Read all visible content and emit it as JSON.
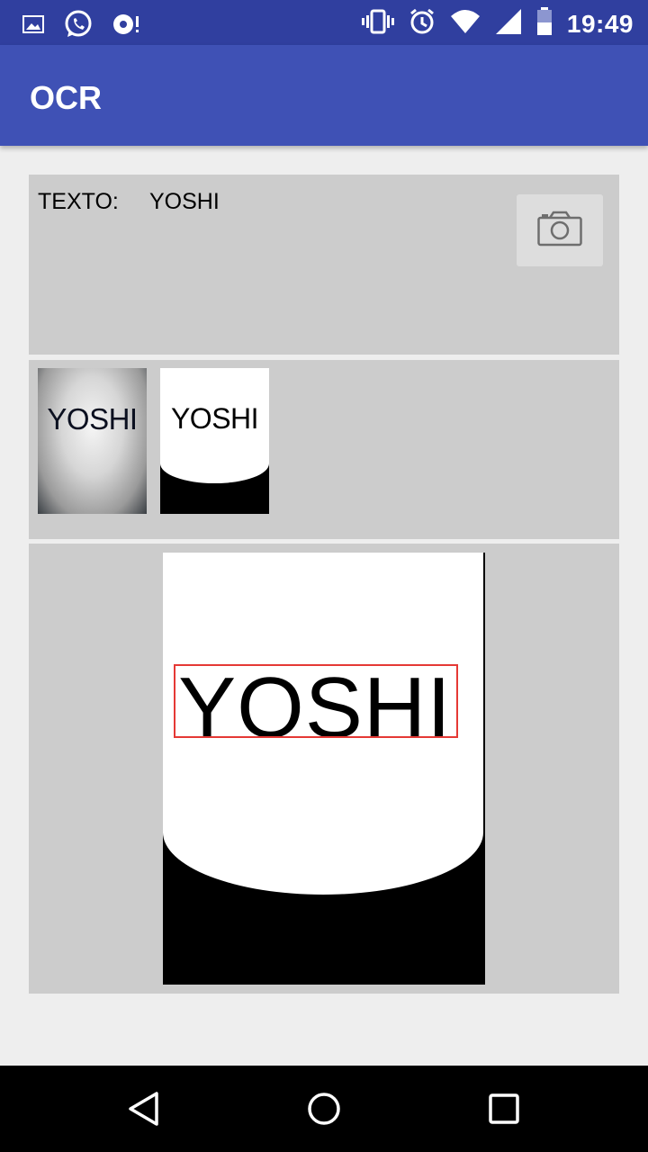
{
  "status_bar": {
    "time": "19:49",
    "left_icons": [
      "image-icon",
      "whatsapp-icon",
      "sync-icon"
    ],
    "right_icons": [
      "vibrate-icon",
      "alarm-icon",
      "wifi-icon",
      "signal-icon",
      "battery-icon"
    ]
  },
  "app_bar": {
    "title": "OCR"
  },
  "result": {
    "label": "TEXTO:",
    "value": "YOSHI"
  },
  "camera_button": {
    "icon": "camera-icon"
  },
  "thumbnails": {
    "original_text": "YOSHI",
    "binarized_text": "YOSHI"
  },
  "preview": {
    "detected_text": "YOSHI",
    "box_color": "#e53935"
  },
  "nav_bar": {
    "icons": [
      "back-icon",
      "home-icon",
      "recents-icon"
    ]
  },
  "colors": {
    "status_bar": "#303f9f",
    "app_bar": "#3f51b5",
    "panel": "#cccccc",
    "background": "#eeeeee"
  }
}
